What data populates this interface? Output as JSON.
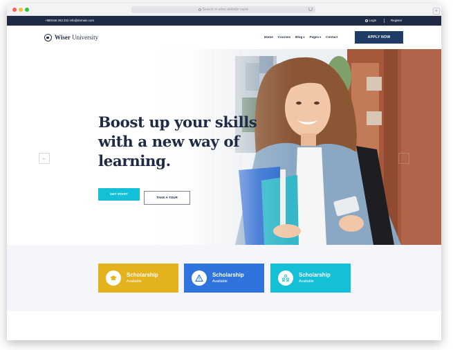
{
  "browser": {
    "url_placeholder": "Search or enter website name"
  },
  "topbar": {
    "contact": "+880166 253 232 info@domain.com",
    "login": "Login",
    "register": "Register"
  },
  "header": {
    "logo_bold": "Wiser",
    "logo_rest": " University",
    "nav": [
      "Home",
      "Courses",
      "Blog",
      "Pages",
      "Contact"
    ],
    "apply": "APPLY NOW"
  },
  "hero": {
    "title_line1": "Boost up your skills",
    "title_line2": "with a new way of",
    "title_line3": "learning.",
    "primary_button": "GET START",
    "secondary_button": "TAKE A TOUR"
  },
  "features": [
    {
      "title": "Scholarship",
      "subtitle": "Available",
      "color": "#e3b21c",
      "icon": "graduation-cap-icon"
    },
    {
      "title": "Scholarship",
      "subtitle": "Available",
      "color": "#2f74dc",
      "icon": "warning-triangle-icon"
    },
    {
      "title": "Scholarship",
      "subtitle": "Available",
      "color": "#14c0d8",
      "icon": "people-icon"
    }
  ],
  "colors": {
    "navy": "#1f2a44",
    "cyan": "#14c0d8",
    "apply_button": "#1f3c66"
  }
}
